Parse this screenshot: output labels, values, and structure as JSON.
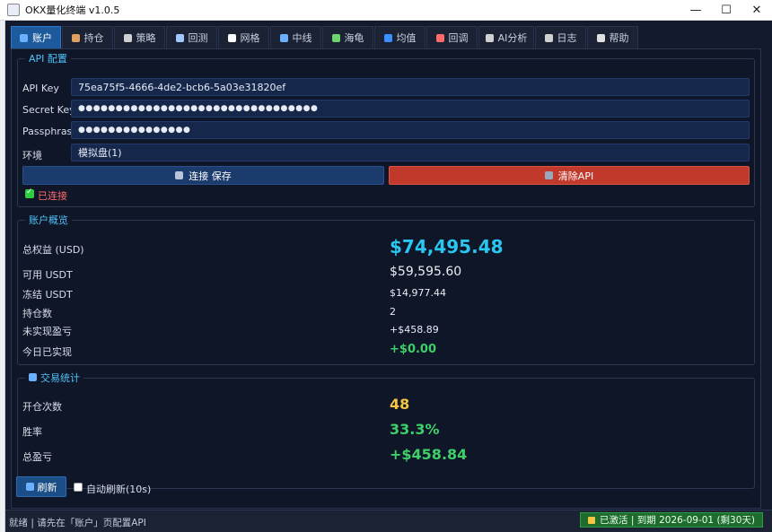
{
  "window": {
    "title": "OKX量化终端 v1.0.5",
    "minimize": "—",
    "maximize": "☐",
    "close": "✕"
  },
  "tabs": [
    {
      "label": "账户",
      "icon": "chart-icon",
      "color": "#6ab0ff"
    },
    {
      "label": "持仓",
      "icon": "package-icon",
      "color": "#e0a060"
    },
    {
      "label": "策略",
      "icon": "shield-icon",
      "color": "#d0d0d0"
    },
    {
      "label": "回测",
      "icon": "flask-icon",
      "color": "#a0c8ff"
    },
    {
      "label": "网格",
      "icon": "grid-icon",
      "color": "#ffffff"
    },
    {
      "label": "中线",
      "icon": "chart-icon",
      "color": "#6ab0ff"
    },
    {
      "label": "海龟",
      "icon": "turtle-icon",
      "color": "#6fd36f"
    },
    {
      "label": "均值",
      "icon": "equals-icon",
      "color": "#3b8fff"
    },
    {
      "label": "回调",
      "icon": "target-icon",
      "color": "#ff6b6b"
    },
    {
      "label": "AI分析",
      "icon": "robot-icon",
      "color": "#d0d0d0"
    },
    {
      "label": "日志",
      "icon": "memo-icon",
      "color": "#d0d0d0"
    },
    {
      "label": "帮助",
      "icon": "book-icon",
      "color": "#e0e0e0"
    }
  ],
  "api": {
    "legend": "API 配置",
    "api_key_label": "API Key",
    "api_key_value": "75ea75f5-4666-4de2-bcb6-5a03e31820ef",
    "secret_label": "Secret Key",
    "secret_value": "●●●●●●●●●●●●●●●●●●●●●●●●●●●●●●●●",
    "pass_label": "Passphrase",
    "pass_value": "●●●●●●●●●●●●●●●",
    "env_label": "环境",
    "env_value": "模拟盘(1)",
    "connect_label": "连接  保存",
    "clear_label": "清除API",
    "status": "已连接"
  },
  "overview": {
    "legend": "账户概览",
    "rows": [
      {
        "label": "总权益 (USD)",
        "value": "$74,495.48"
      },
      {
        "label": "可用 USDT",
        "value": "$59,595.60"
      },
      {
        "label": "冻结 USDT",
        "value": "$14,977.44"
      },
      {
        "label": "持仓数",
        "value": "2"
      },
      {
        "label": "未实现盈亏",
        "value": "+$458.89"
      },
      {
        "label": "今日已实现",
        "value": "+$0.00"
      }
    ]
  },
  "stats": {
    "legend": "交易统计",
    "rows": [
      {
        "label": "开仓次数",
        "value": "48"
      },
      {
        "label": "胜率",
        "value": "33.3%"
      },
      {
        "label": "总盈亏",
        "value": "+$458.84"
      }
    ]
  },
  "controls": {
    "refresh": "刷新",
    "auto_refresh": "自动刷新(10s)"
  },
  "statusbar": {
    "text": "就绪 | 请先在「账户」页配置API",
    "license": "已激活 | 到期 2026-09-01 (剩30天)"
  }
}
